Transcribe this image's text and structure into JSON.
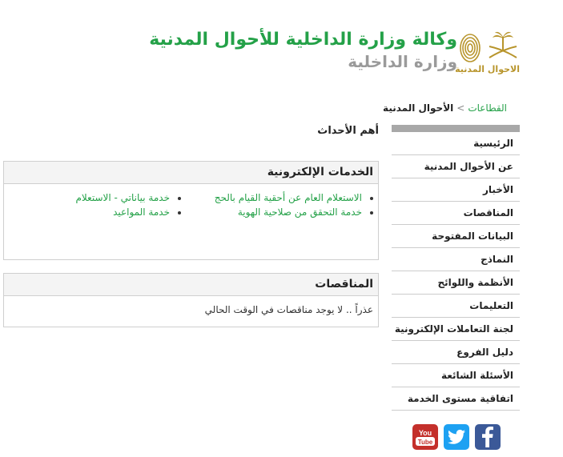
{
  "header": {
    "agency_name": "وكالة وزارة الداخلية للأحوال المدنية",
    "ministry_name": "وزارة الداخلية",
    "emblem_caption": "الاحوال المدنية"
  },
  "breadcrumb": {
    "root": "القطاعات",
    "separator": ">",
    "current": "الأحوال المدنية"
  },
  "sidebar": {
    "items": [
      {
        "label": "الرئيسية"
      },
      {
        "label": "عن الأحوال المدنية"
      },
      {
        "label": "الأخبار"
      },
      {
        "label": "المناقصات"
      },
      {
        "label": "البيانات المفتوحة"
      },
      {
        "label": "النماذج"
      },
      {
        "label": "الأنظمة واللوائح"
      },
      {
        "label": "التعليمات"
      },
      {
        "label": "لجنة التعاملات الإلكترونية"
      },
      {
        "label": "دليل الفروع"
      },
      {
        "label": "الأسئلة الشائعة"
      },
      {
        "label": "اتفاقية مستوى الخدمة"
      }
    ]
  },
  "main": {
    "events_title": "أهم الأحداث",
    "eservices": {
      "title": "الخدمات الإلكترونية",
      "col1": [
        "الاستعلام العام عن أحقية القيام بالحج",
        "خدمة التحقق من صلاحية الهوية"
      ],
      "col2": [
        "خدمة بياناتي - الاستعلام",
        "خدمة المواعيد"
      ]
    },
    "tenders": {
      "title": "المناقصات",
      "message": "عذراً .. لا يوجد مناقصات في الوقت الحالي"
    }
  },
  "social": {
    "youtube_label": "You",
    "youtube_label2": "Tube"
  },
  "colors": {
    "accent_green": "#24a148",
    "gray_text": "#9a9a9a",
    "gold": "#b8952c"
  }
}
